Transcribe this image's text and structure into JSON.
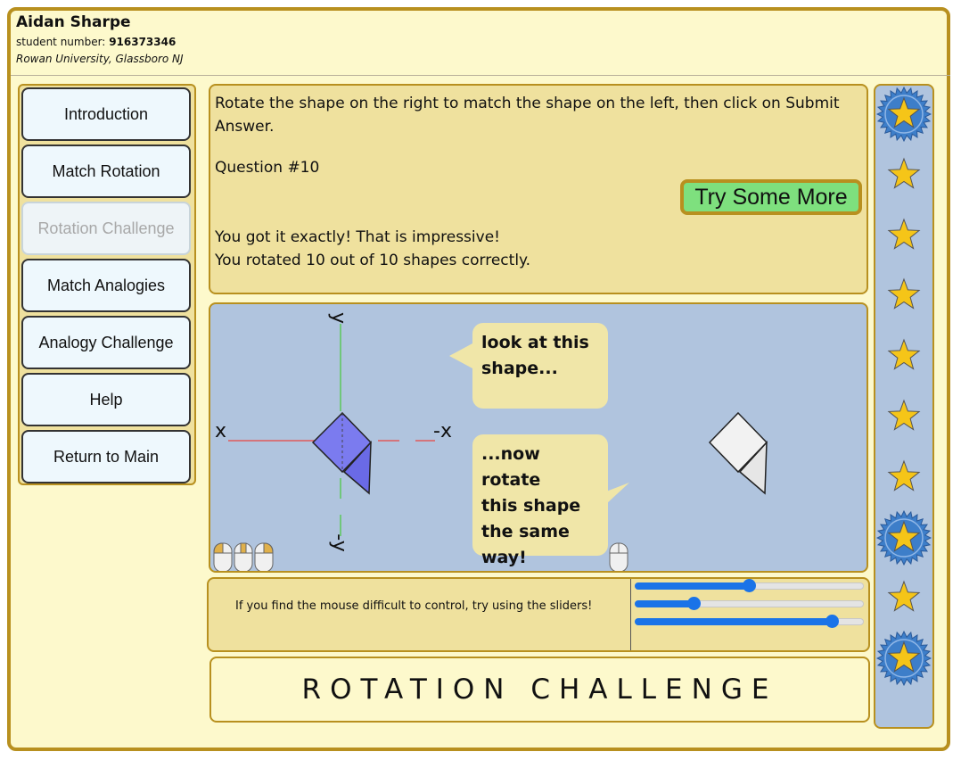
{
  "header": {
    "name": "Aidan Sharpe",
    "student_label": "student number:",
    "student_number": "916373346",
    "university": "Rowan University, Glassboro NJ"
  },
  "nav": {
    "items": [
      {
        "label": "Introduction",
        "disabled": false
      },
      {
        "label": "Match Rotation",
        "disabled": false
      },
      {
        "label": "Rotation Challenge",
        "disabled": true
      },
      {
        "label": "Match Analogies",
        "disabled": false
      },
      {
        "label": "Analogy Challenge",
        "disabled": false
      },
      {
        "label": "Help",
        "disabled": false
      },
      {
        "label": "Return to Main",
        "disabled": false
      }
    ]
  },
  "question": {
    "instructions_line1": "Rotate the shape on the right to match the shape on the left, then click on Submit",
    "instructions_line2": "Answer.",
    "number": "Question #10",
    "try_label": "Try Some More",
    "result_line1": "You got it exactly! That is impressive!",
    "result_line2": "You rotated 10 out of 10 shapes correctly."
  },
  "canvas": {
    "axis_x_left": "x",
    "axis_x_right": "-x",
    "axis_y_top": "y",
    "axis_y_bottom": "-y",
    "bubble_look_line1": "look at this",
    "bubble_look_line2": "shape...",
    "bubble_rotate_line1": "...now rotate",
    "bubble_rotate_line2": "this shape",
    "bubble_rotate_line3": "the same",
    "bubble_rotate_line4": "way!",
    "colors": {
      "background": "#b0c4de",
      "target_shape": "#7b7bef",
      "user_shape": "#f2f2f2",
      "x_axis": "#e05a5a",
      "y_axis": "#5ac85a"
    }
  },
  "sliders": {
    "hint": "If you find the mouse difficult to control, try using the sliders!",
    "values": [
      0.5,
      0.26,
      0.86
    ]
  },
  "title": "ROTATION CHALLENGE",
  "stars": [
    "badge",
    "star",
    "star",
    "star",
    "star",
    "star",
    "star",
    "badge",
    "star",
    "badge"
  ],
  "colors": {
    "border": "#b8901f",
    "panel": "#efe19e",
    "page": "#fdf9cc",
    "star_fill": "#f5c518",
    "badge_fill": "#3d7ec9",
    "slider": "#1a73e8",
    "try_button": "#7ee07e"
  }
}
